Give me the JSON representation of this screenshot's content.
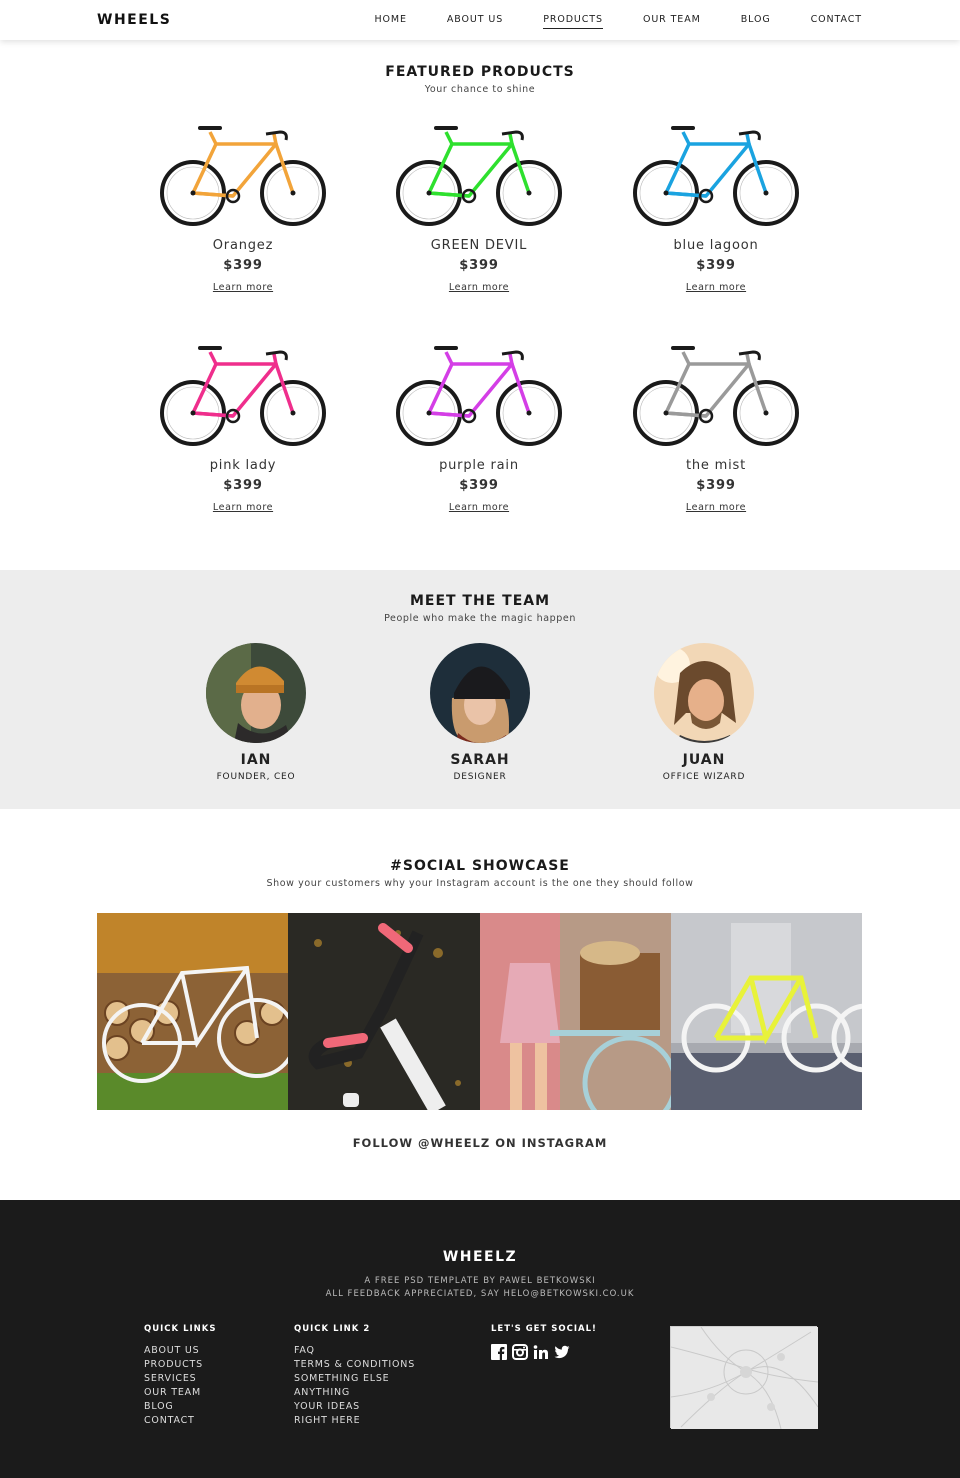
{
  "header": {
    "logo": "WHEELS",
    "nav": [
      "HOME",
      "ABOUT US",
      "PRODUCTS",
      "OUR TEAM",
      "BLOG",
      "CONTACT"
    ],
    "active_nav": "PRODUCTS"
  },
  "products": {
    "title": "FEATURED PRODUCTS",
    "subtitle": "Your chance to shine",
    "items": [
      {
        "name": "Orangez",
        "price": "$399",
        "link": "Learn more",
        "color": "#f2a43a"
      },
      {
        "name": "GREEN DEVIL",
        "price": "$399",
        "link": "Learn more",
        "color": "#2ee02e"
      },
      {
        "name": "blue lagoon",
        "price": "$399",
        "link": "Learn more",
        "color": "#1aa3e0"
      },
      {
        "name": "pink lady",
        "price": "$399",
        "link": "Learn more",
        "color": "#ef2e8c"
      },
      {
        "name": "purple rain",
        "price": "$399",
        "link": "Learn more",
        "color": "#d43ee6"
      },
      {
        "name": "the mist",
        "price": "$399",
        "link": "Learn more",
        "color": "#9a9a9a"
      }
    ]
  },
  "team": {
    "title": "MEET THE TEAM",
    "subtitle": "People who make the magic happen",
    "members": [
      {
        "name": "IAN",
        "role": "FOUNDER, CEO"
      },
      {
        "name": "SARAH",
        "role": "DESIGNER"
      },
      {
        "name": "JUAN",
        "role": "OFFICE WIZARD"
      }
    ]
  },
  "social": {
    "title": "#SOCIAL SHOWCASE",
    "subtitle": "Show your customers why your Instagram account is the one they should follow",
    "follow": "FOLLOW @WHEELZ ON INSTAGRAM"
  },
  "footer": {
    "logo": "WHEELZ",
    "line1": "A FREE PSD TEMPLATE BY PAWEL BETKOWSKI",
    "line2": "ALL FEEDBACK APPRECIATED, SAY HELO@BETKOWSKI.CO.UK",
    "quick_links": {
      "title": "QUICK LINKS",
      "items": [
        "ABOUT US",
        "PRODUCTS",
        "SERVICES",
        "OUR TEAM",
        "BLOG",
        "CONTACT"
      ]
    },
    "quick_links_2": {
      "title": "QUICK LINK 2",
      "items": [
        "FAQ",
        "TERMS & CONDITIONS",
        "SOMETHING ELSE",
        "ANYTHING",
        "YOUR IDEAS",
        "RIGHT HERE"
      ]
    },
    "social": {
      "title": "LET'S GET SOCIAL!",
      "icons": [
        "facebook-icon",
        "instagram-icon",
        "linkedin-icon",
        "twitter-icon"
      ]
    }
  }
}
